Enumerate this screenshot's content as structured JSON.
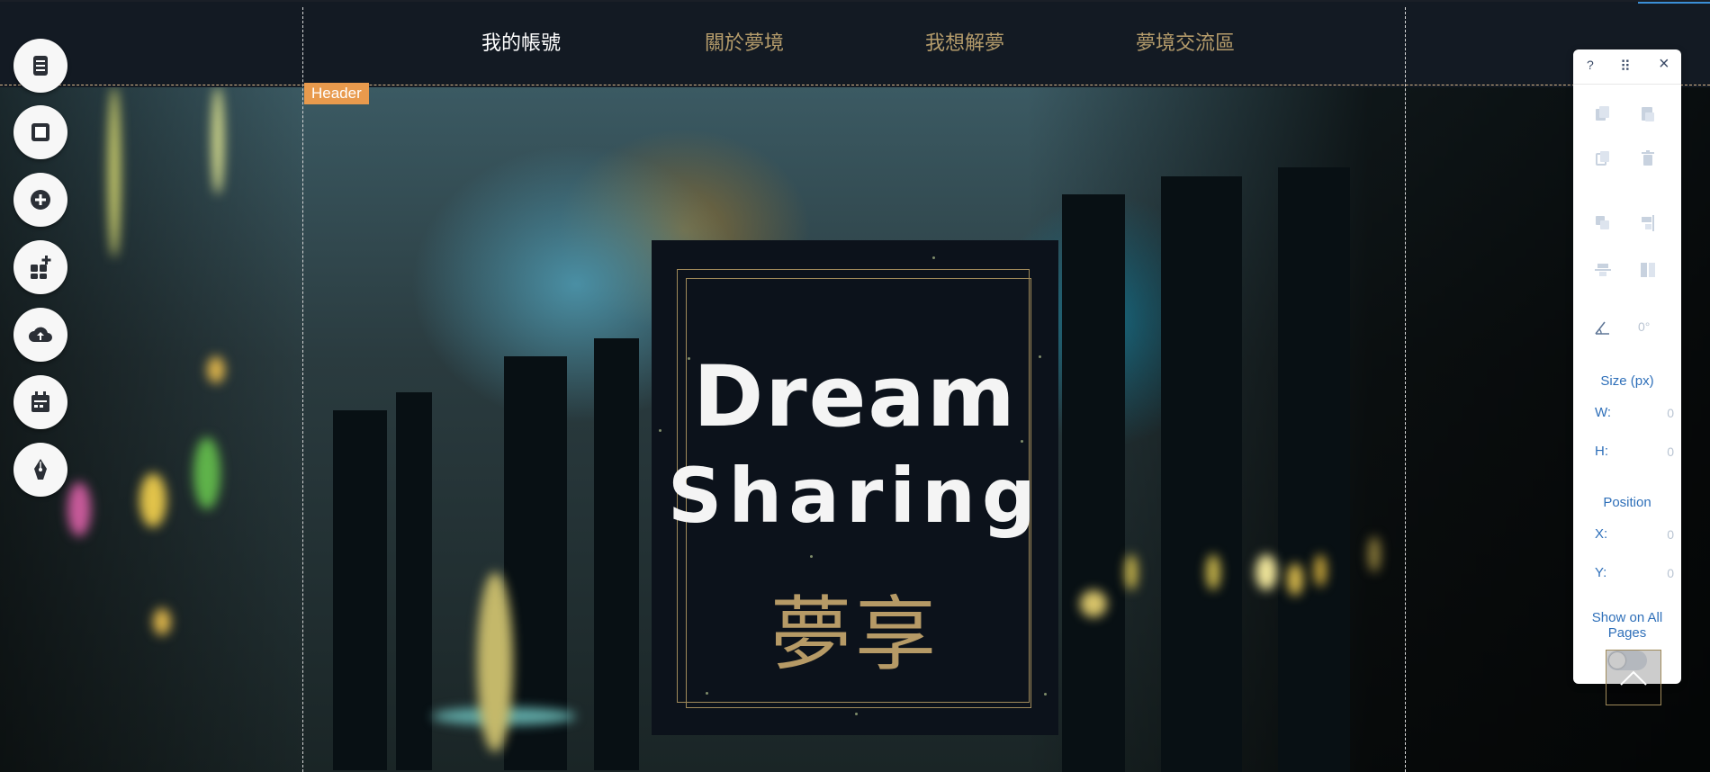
{
  "header": {
    "nav": [
      "我的帳號",
      "關於夢境",
      "我想解夢",
      "夢境交流區"
    ],
    "active_color": "#ffffff",
    "inactive_color": "#b59c6b",
    "tag_label": "Header"
  },
  "logo": {
    "line1": "Dream",
    "line2": "Sharing",
    "line3": "夢享"
  },
  "left_rail": {
    "buttons": [
      "pages-icon",
      "background-icon",
      "add-icon",
      "app-market-icon",
      "upload-icon",
      "calendar-icon",
      "pen-icon"
    ]
  },
  "panel": {
    "help": "?",
    "drag_handle": "⠿",
    "close": "×",
    "rotation_value": "0°",
    "size_label": "Size (px)",
    "w_label": "W:",
    "w_value": "0",
    "h_label": "H:",
    "h_value": "0",
    "position_label": "Position",
    "x_label": "X:",
    "x_value": "0",
    "y_label": "Y:",
    "y_value": "0",
    "show_all_pages": "Show on All Pages"
  }
}
